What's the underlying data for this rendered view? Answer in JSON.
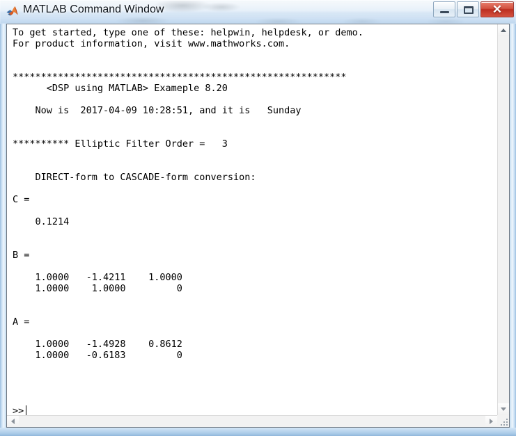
{
  "window": {
    "title": "MATLAB Command Window",
    "app_icon": "matlab-membrane-icon",
    "controls": {
      "minimize_label": "—",
      "maximize_label": "□",
      "close_label": "✕"
    }
  },
  "console": {
    "text": "To get started, type one of these: helpwin, helpdesk, or demo.\nFor product information, visit www.mathworks.com.\n\n\n***********************************************************\n      <DSP using MATLAB> Exameple 8.20\n\n    Now is  2017-04-09 10:28:51, and it is   Sunday\n\n\n********** Elliptic Filter Order =   3\n\n\n    DIRECT-form to CASCADE-form conversion:\n\nC =\n\n    0.1214\n\n\nB =\n\n    1.0000   -1.4211    1.0000\n    1.0000    1.0000         0\n\n\nA =\n\n    1.0000   -1.4928    0.8612\n    1.0000   -0.6183         0",
    "lines": [
      "To get started, type one of these: helpwin, helpdesk, or demo.",
      "For product information, visit www.mathworks.com.",
      "",
      "",
      "***********************************************************",
      "      <DSP using MATLAB> Exameple 8.20",
      "",
      "    Now is  2017-04-09 10:28:51, and it is   Sunday",
      "",
      "",
      "********** Elliptic Filter Order =   3",
      "",
      "",
      "    DIRECT-form to CASCADE-form conversion:",
      "",
      "C =",
      "",
      "    0.1214",
      "",
      "",
      "B =",
      "",
      "    1.0000   -1.4211    1.0000",
      "    1.0000    1.0000         0",
      "",
      "",
      "A =",
      "",
      "    1.0000   -1.4928    0.8612",
      "    1.0000   -0.6183         0"
    ],
    "startup_message": {
      "line1": "To get started, type one of these: helpwin, helpdesk, or demo.",
      "line2": "For product information, visit www.mathworks.com."
    },
    "banner": {
      "separator": "***********************************************************",
      "title": "<DSP using MATLAB> Exameple 8.20",
      "timestamp_line": "Now is  2017-04-09 10:28:51, and it is   Sunday",
      "date": "2017-04-09",
      "time": "10:28:51",
      "weekday": "Sunday"
    },
    "filter": {
      "header": "********** Elliptic Filter Order =   3",
      "type": "Elliptic",
      "order": "3",
      "conversion_label": "DIRECT-form to CASCADE-form conversion:"
    },
    "matrices": {
      "C": {
        "name": "C =",
        "rows": [
          [
            "0.1214"
          ]
        ]
      },
      "B": {
        "name": "B =",
        "rows": [
          [
            "1.0000",
            "-1.4211",
            "1.0000"
          ],
          [
            "1.0000",
            "1.0000",
            "0"
          ]
        ]
      },
      "A": {
        "name": "A =",
        "rows": [
          [
            "1.0000",
            "-1.4928",
            "0.8612"
          ],
          [
            "1.0000",
            "-0.6183",
            "0"
          ]
        ]
      }
    },
    "prompt": ">>",
    "command_input": ""
  },
  "scrollbars": {
    "vertical": {
      "up_icon": "arrow-up-icon",
      "down_icon": "arrow-down-icon"
    },
    "horizontal": {
      "left_icon": "arrow-left-icon",
      "right_icon": "arrow-right-icon"
    },
    "resize_grip": "resize-grip-icon"
  },
  "colors": {
    "console_bg": "#ffffff",
    "console_fg": "#000000",
    "titlebar_tint": "#cfe0f2",
    "close_button": "#bc2e20",
    "frame_border": "#6e7781"
  }
}
